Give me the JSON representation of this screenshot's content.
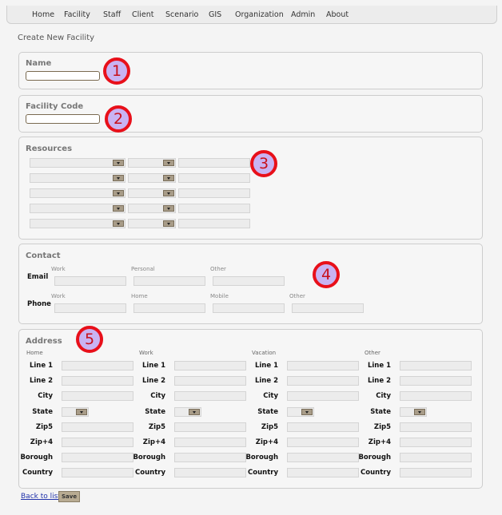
{
  "nav": {
    "items": [
      "Home",
      "Facility",
      "Staff",
      "Client",
      "Scenario",
      "GIS",
      "Organization",
      "Admin",
      "About"
    ]
  },
  "page": {
    "title": "Create New Facility"
  },
  "name_section": {
    "legend": "Name",
    "value": ""
  },
  "code_section": {
    "legend": "Facility Code",
    "value": ""
  },
  "resources": {
    "legend": "Resources",
    "rows": 5
  },
  "contact": {
    "legend": "Contact",
    "email_label": "Email",
    "phone_label": "Phone",
    "email_cols": [
      "Work",
      "Personal",
      "Other"
    ],
    "phone_cols": [
      "Work",
      "Home",
      "Mobile",
      "Other"
    ]
  },
  "address": {
    "legend": "Address",
    "columns": [
      "Home",
      "Work",
      "Vacation",
      "Other"
    ],
    "fields": [
      "Line 1",
      "Line 2",
      "City",
      "State",
      "Zip5",
      "Zip+4",
      "Borough",
      "Country"
    ]
  },
  "callouts": [
    "1",
    "2",
    "3",
    "4",
    "5"
  ],
  "footer": {
    "back_label": "Back to list",
    "save_label": "Save"
  },
  "colors": {
    "badge_fill": "#c9b3f2",
    "badge_ring": "#e8101a"
  }
}
